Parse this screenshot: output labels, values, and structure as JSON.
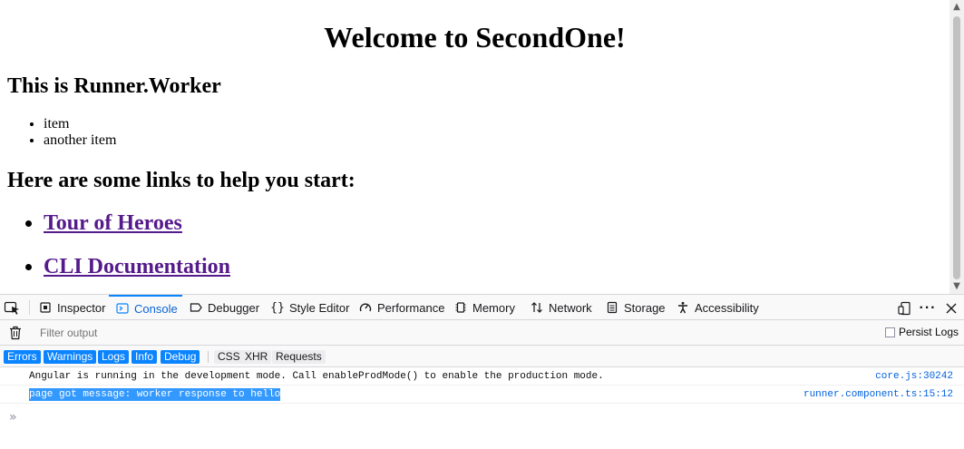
{
  "page": {
    "heading": "Welcome to SecondOne!",
    "subheading": "This is Runner.Worker",
    "items": [
      "item",
      "another item"
    ],
    "links_heading": "Here are some links to help you start:",
    "links": [
      "Tour of Heroes",
      "CLI Documentation"
    ],
    "link_color": "#551a8b"
  },
  "devtools": {
    "tabs": [
      {
        "label": "Inspector",
        "icon": "inspector-icon"
      },
      {
        "label": "Console",
        "icon": "console-icon",
        "selected": true
      },
      {
        "label": "Debugger",
        "icon": "debugger-icon"
      },
      {
        "label": "Style Editor",
        "icon": "style-editor-icon"
      },
      {
        "label": "Performance",
        "icon": "performance-icon"
      },
      {
        "label": "Memory",
        "icon": "memory-icon"
      },
      {
        "label": "Network",
        "icon": "network-icon"
      },
      {
        "label": "Storage",
        "icon": "storage-icon"
      },
      {
        "label": "Accessibility",
        "icon": "accessibility-icon"
      }
    ],
    "filter_placeholder": "Filter output",
    "persist_logs": "Persist Logs",
    "levels": [
      "Errors",
      "Warnings",
      "Logs",
      "Info",
      "Debug"
    ],
    "categories": [
      "CSS",
      "XHR",
      "Requests"
    ],
    "messages": [
      {
        "text": "Angular is running in the development mode. Call enableProdMode() to enable the production mode.",
        "source": "core.js:30242",
        "selected": false
      },
      {
        "text": "page got message: worker response to hello",
        "source": "runner.component.ts:15:12",
        "selected": true
      }
    ],
    "accent_color": "#0a84ff"
  }
}
